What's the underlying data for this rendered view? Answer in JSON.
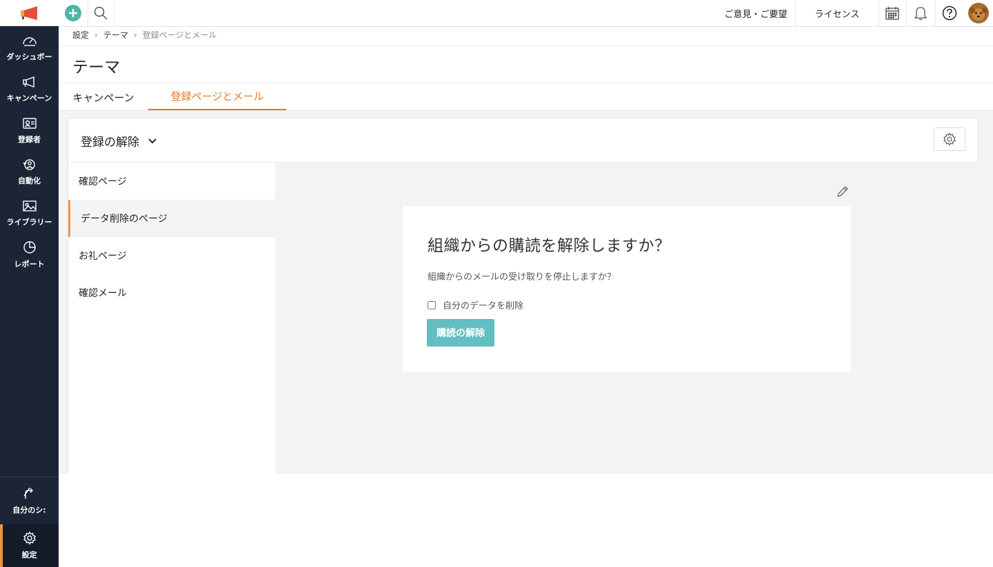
{
  "sidebar": {
    "items": [
      {
        "label": "ダッシュボー",
        "icon": "dashboard-icon"
      },
      {
        "label": "キャンペーン",
        "icon": "megaphone-icon"
      },
      {
        "label": "登録者",
        "icon": "contact-card-icon"
      },
      {
        "label": "自動化",
        "icon": "automation-icon"
      },
      {
        "label": "ライブラリー",
        "icon": "image-library-icon"
      },
      {
        "label": "レポート",
        "icon": "pie-chart-icon"
      }
    ],
    "bottom": [
      {
        "label": "自分のシ:",
        "icon": "signup-share-icon"
      },
      {
        "label": "設定",
        "icon": "gear-icon"
      }
    ]
  },
  "topbar": {
    "feedback_label": "ご意見・ご要望",
    "license_label": "ライセンス"
  },
  "breadcrumb": {
    "items": [
      "設定",
      "テーマ",
      "登録ページとメール"
    ],
    "separator": "›"
  },
  "page": {
    "title": "テーマ"
  },
  "tabs": [
    {
      "label": "キャンペーン",
      "active": false
    },
    {
      "label": "登録ページとメール",
      "active": true
    }
  ],
  "card": {
    "dropdown_label": "登録の解除",
    "list": [
      {
        "label": "確認ページ",
        "active": false
      },
      {
        "label": "データ削除のページ",
        "active": true
      },
      {
        "label": "お礼ページ",
        "active": false
      },
      {
        "label": "確認メール",
        "active": false
      }
    ]
  },
  "preview": {
    "title": "組織からの購読を解除しますか？",
    "subtitle": "組織からのメールの受け取りを停止しますか？",
    "checkbox_label": "自分のデータを削除",
    "button_label": "購読の解除"
  },
  "colors": {
    "sidebar_bg": "#1c2536",
    "accent_orange": "#e8762b",
    "button_teal": "#62bec0",
    "add_button": "#4db6ac"
  }
}
